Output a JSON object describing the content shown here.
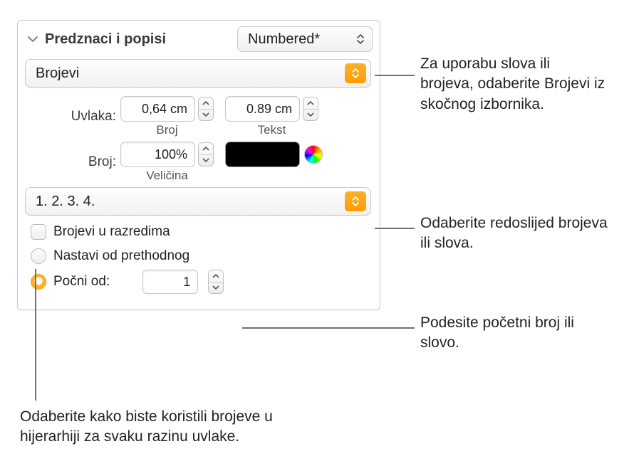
{
  "header": {
    "title": "Predznaci i popisi",
    "style_label": "Numbered*"
  },
  "type_popup": "Brojevi",
  "indent": {
    "label": "Uvlaka:",
    "number_value": "0,64 cm",
    "number_caption": "Broj",
    "text_value": "0.89 cm",
    "text_caption": "Tekst"
  },
  "size": {
    "label": "Broj:",
    "value": "100%",
    "caption": "Veličina"
  },
  "format_popup": "1. 2. 3. 4.",
  "tiered_checkbox": "Brojevi u razredima",
  "radio_continue": "Nastavi od prethodnog",
  "radio_start": "Počni od:",
  "start_value": "1",
  "callouts": {
    "c1": "Za uporabu slova ili brojeva, odaberite Brojevi iz skočnog izbornika.",
    "c2": "Odaberite redoslijed brojeva ili slova.",
    "c3": "Podesite početni broj ili slovo.",
    "c4": "Odaberite kako biste koristili brojeve u hijerarhiji za svaku razinu uvlake."
  }
}
